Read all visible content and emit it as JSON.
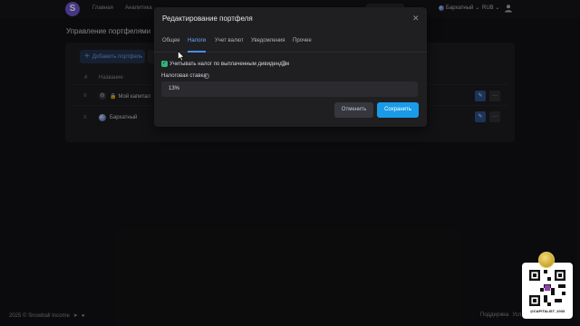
{
  "nav": {
    "logo_letter": "S",
    "home": "Главная",
    "analytics": "Аналитика",
    "portfolio": "Бархатный",
    "currency": "RUB"
  },
  "page": {
    "title": "Управление портфелями",
    "add_button": "Добавить портфель",
    "columns": {
      "num": "#",
      "name": "Название"
    },
    "rows": [
      {
        "name": "Мой капитал",
        "locked": true
      },
      {
        "name": "Бархатный",
        "locked": false
      }
    ]
  },
  "modal": {
    "title": "Редактирование портфеля",
    "tabs": [
      "Общее",
      "Налоги",
      "Учет валют",
      "Уведомления",
      "Прочее"
    ],
    "active_tab": "Налоги",
    "checkbox_label": "Учитывать налог по выплаченным дивидендам",
    "checkbox_checked": true,
    "rate_label": "Налоговая ставка",
    "rate_value": "13%",
    "cancel": "Отменить",
    "save": "Сохранить"
  },
  "footer": {
    "brand": "2025 © Snowball Income",
    "support": "Поддержка",
    "other": "Усл"
  },
  "watermark": {
    "caption": "@CAPITALIST_2033"
  },
  "colors": {
    "accent": "#1a9be8",
    "tab_active": "#6da7ff",
    "check": "#2fb67a",
    "logo": "#6c54c9"
  }
}
